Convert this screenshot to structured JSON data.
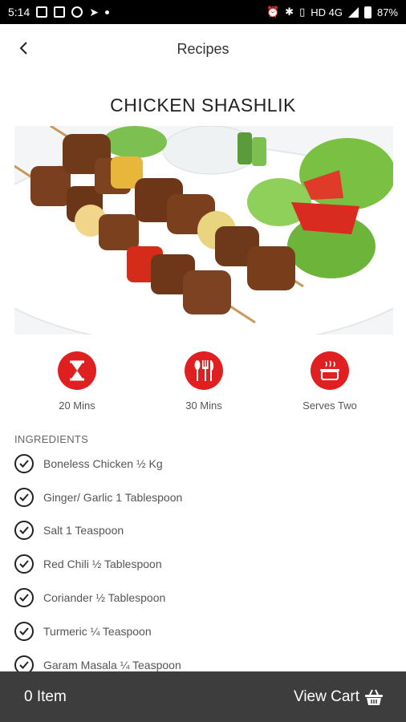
{
  "status_bar": {
    "time": "5:14",
    "network": "HD 4G",
    "battery": "87%"
  },
  "app_bar": {
    "title": "Recipes"
  },
  "recipe": {
    "title": "CHICKEN SHASHLIK",
    "stats": [
      {
        "label": "20 Mins",
        "icon": "hourglass-icon"
      },
      {
        "label": "30 Mins",
        "icon": "cutlery-icon"
      },
      {
        "label": "Serves Two",
        "icon": "cooking-pot-icon"
      }
    ],
    "ingredients_heading": "INGREDIENTS",
    "ingredients": [
      "Boneless Chicken ½ Kg",
      "Ginger/ Garlic 1 Tablespoon",
      "Salt 1 Teaspoon",
      "Red Chili ½ Tablespoon",
      "Coriander ½ Tablespoon",
      "Turmeric ¼ Teaspoon",
      "Garam Masala ¼ Teaspoon"
    ]
  },
  "cart": {
    "item_count": "0 Item",
    "view_cart_label": "View Cart"
  },
  "colors": {
    "accent": "#e02020",
    "bottom_bar": "#3d3d3d",
    "status_bar": "#000000"
  }
}
